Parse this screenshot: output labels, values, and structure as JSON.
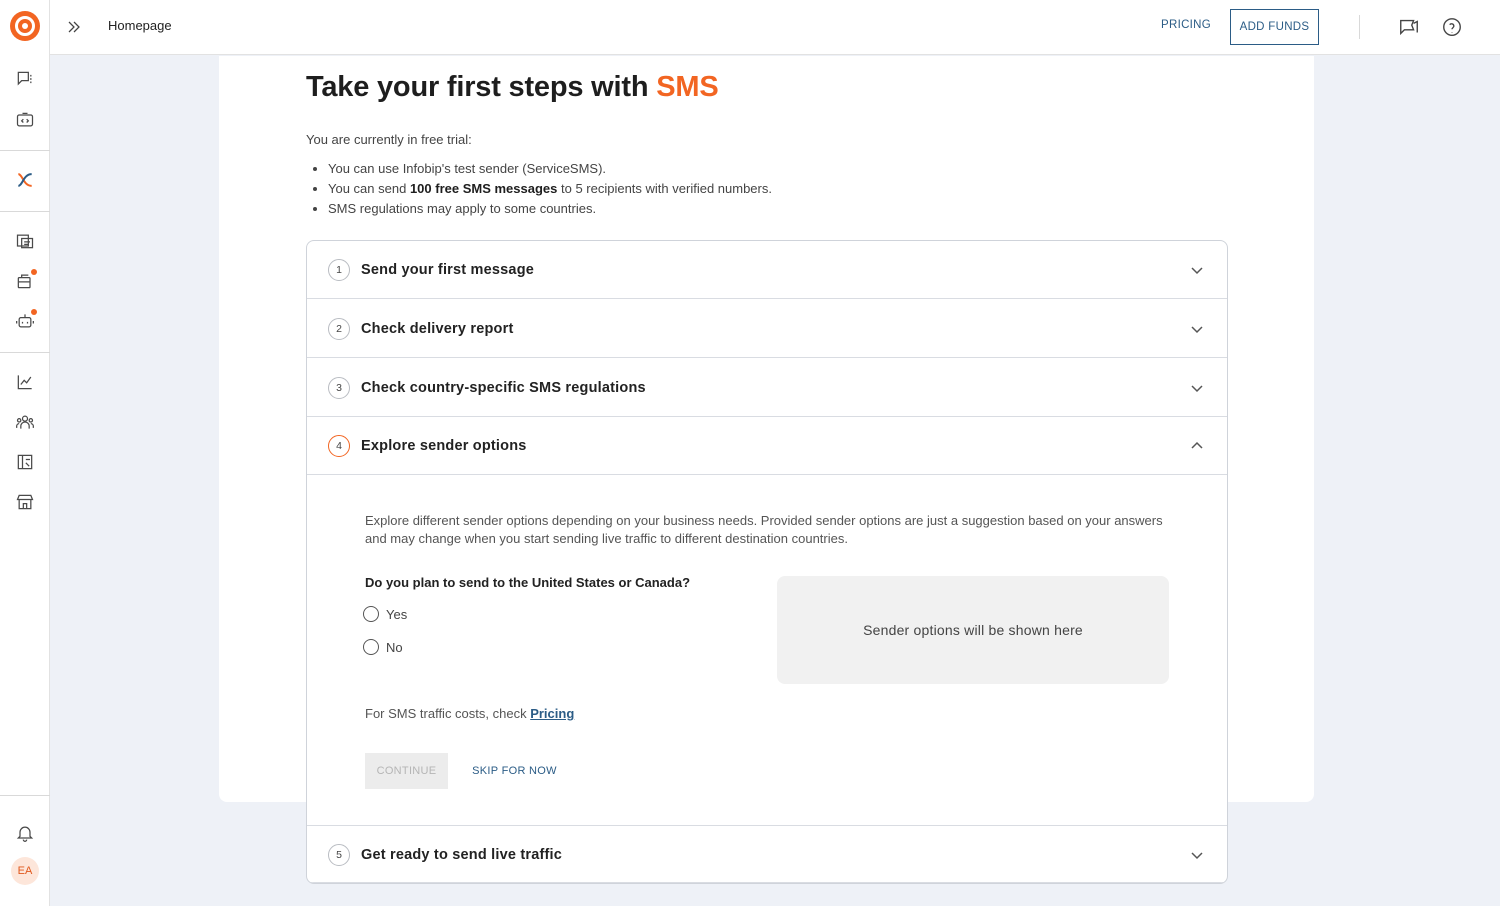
{
  "header": {
    "breadcrumb": "Homepage",
    "pricing_label": "PRICING",
    "add_funds_label": "ADD FUNDS"
  },
  "sidebar": {
    "avatar_initials": "EA",
    "icons": [
      "conversations-icon",
      "developer-tools-icon",
      "moments-icon",
      "campaigns-icon",
      "channels-icon",
      "chatbots-icon",
      "analytics-icon",
      "people-icon",
      "exchange-icon",
      "marketplace-icon",
      "notifications-icon"
    ]
  },
  "main": {
    "title_prefix": "Take your first steps with ",
    "title_accent": "SMS",
    "intro": "You are currently in free trial:",
    "bullets": {
      "b1": "You can use Infobip's test sender (ServiceSMS).",
      "b2_pre": "You can send ",
      "b2_bold": "100 free SMS messages",
      "b2_post": " to 5 recipients with verified numbers.",
      "b3": "SMS regulations may apply to some countries."
    },
    "steps": [
      {
        "num": "1",
        "label": "Send your first message"
      },
      {
        "num": "2",
        "label": "Check delivery report"
      },
      {
        "num": "3",
        "label": "Check country-specific SMS regulations"
      },
      {
        "num": "4",
        "label": "Explore sender options"
      },
      {
        "num": "5",
        "label": "Get ready to send live traffic"
      }
    ],
    "expanded": {
      "description": "Explore different sender options depending on your business needs. Provided sender options are just a suggestion based on your answers and may change when you start sending live traffic to different destination countries.",
      "question": "Do you plan to send to the United States or Canada?",
      "options": [
        "Yes",
        "No"
      ],
      "sender_placeholder": "Sender options will be shown here",
      "cost_text": "For SMS traffic costs, check ",
      "cost_link": "Pricing",
      "continue_label": "CONTINUE",
      "skip_label": "SKIP FOR NOW"
    }
  },
  "colors": {
    "accent": "#f26522",
    "link": "#2b5c86"
  }
}
